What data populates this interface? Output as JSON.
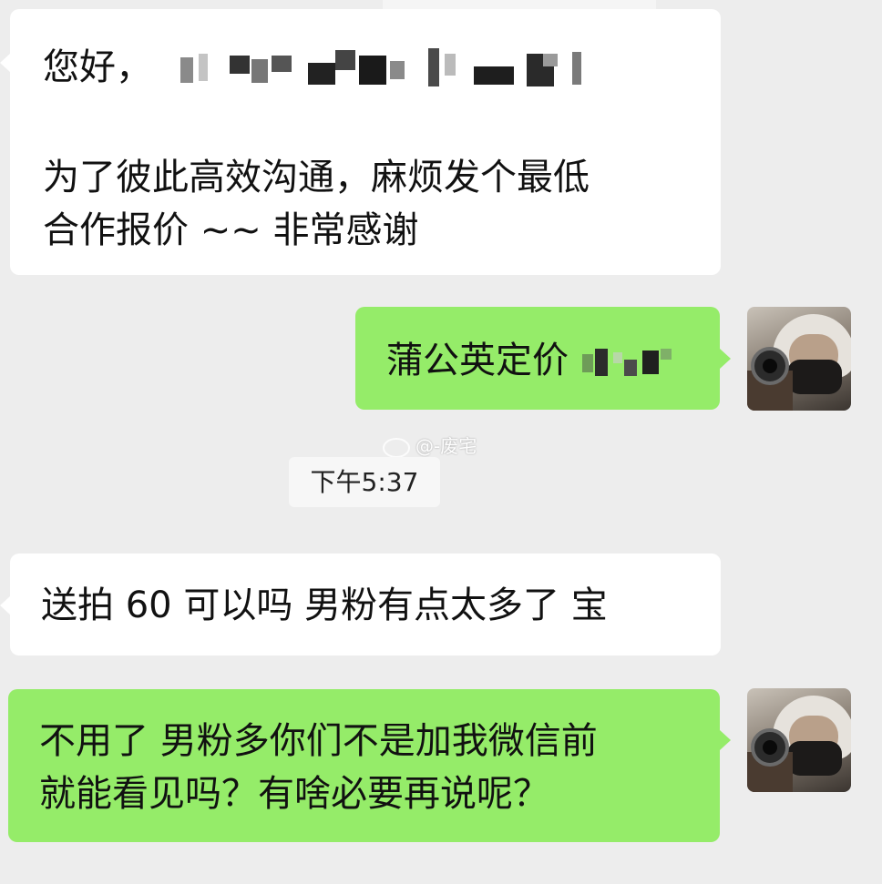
{
  "messages": [
    {
      "side": "incoming",
      "lines": [
        "您好，",
        "",
        "为了彼此高效沟通，麻烦发个最低",
        "合作报价 ~~ 非常感谢"
      ]
    },
    {
      "side": "outgoing",
      "lines": [
        "蒲公英定价"
      ]
    },
    {
      "side": "incoming",
      "lines": [
        "送拍 60 可以吗  男粉有点太多了 宝"
      ]
    },
    {
      "side": "outgoing",
      "lines": [
        "不用了 男粉多你们不是加我微信前",
        "就能看见吗？有啥必要再说呢？"
      ]
    }
  ],
  "timestamp": "下午5:37",
  "watermark": "@-废宅",
  "colors": {
    "background": "#ededed",
    "incoming_bubble": "#ffffff",
    "outgoing_bubble": "#95ec69"
  }
}
